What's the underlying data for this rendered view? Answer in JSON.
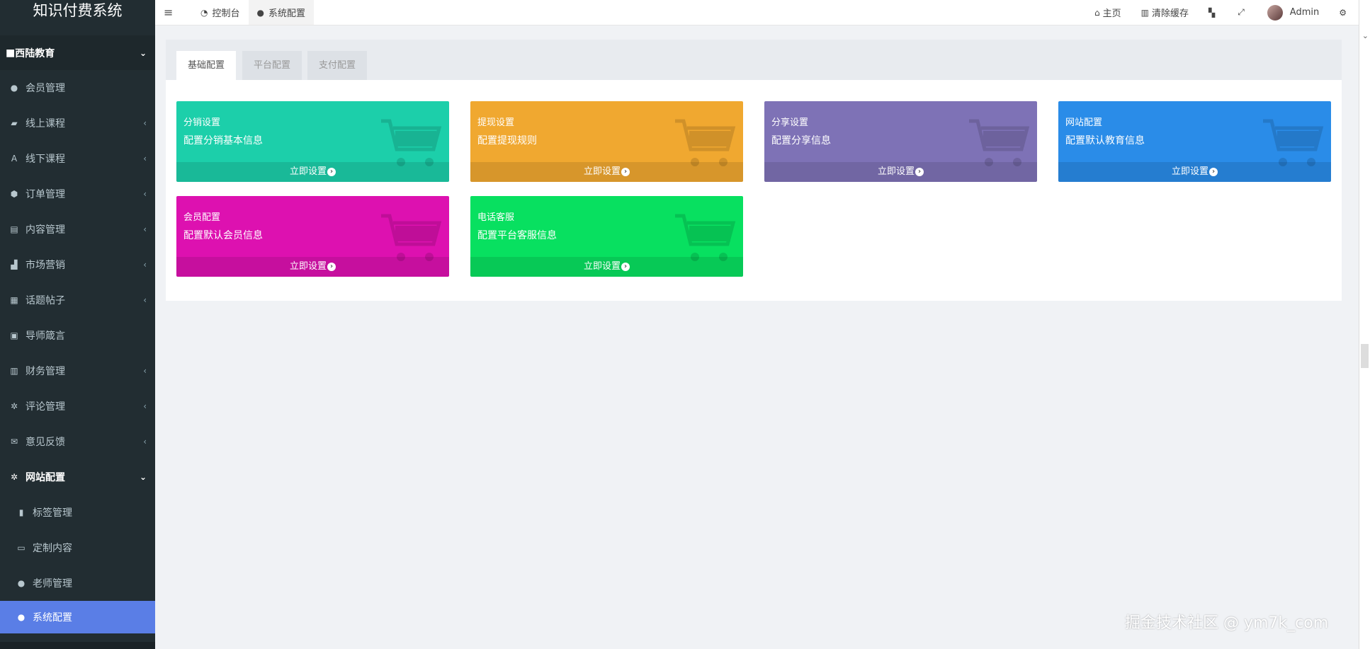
{
  "app": {
    "title": "知识付费系统"
  },
  "sidebar": {
    "group": {
      "label": "西陆教育",
      "icon": "folder-icon"
    },
    "items": [
      {
        "label": "会员管理",
        "icon": "user-icon",
        "caret": ""
      },
      {
        "label": "线上课程",
        "icon": "book-icon",
        "caret": "‹"
      },
      {
        "label": "线下课程",
        "icon": "font-icon",
        "caret": "‹"
      },
      {
        "label": "订单管理",
        "icon": "cube-icon",
        "caret": "‹"
      },
      {
        "label": "内容管理",
        "icon": "list-icon",
        "caret": "‹"
      },
      {
        "label": "市场营销",
        "icon": "chart-icon",
        "caret": "‹"
      },
      {
        "label": "话题帖子",
        "icon": "file-icon",
        "caret": "‹"
      },
      {
        "label": "导师箴言",
        "icon": "calendar-icon",
        "caret": ""
      },
      {
        "label": "财务管理",
        "icon": "bank-icon",
        "caret": "‹"
      },
      {
        "label": "评论管理",
        "icon": "gear-icon",
        "caret": "‹"
      },
      {
        "label": "意见反馈",
        "icon": "envelope-icon",
        "caret": "‹"
      }
    ],
    "group2": {
      "label": "网站配置",
      "icon": "gear-icon"
    },
    "subitems": [
      {
        "label": "标签管理",
        "icon": "bookmark-icon"
      },
      {
        "label": "定制内容",
        "icon": "folder-open-icon"
      },
      {
        "label": "老师管理",
        "icon": "user-plus-icon"
      },
      {
        "label": "系统配置",
        "icon": "user-plus-icon"
      }
    ]
  },
  "topbar": {
    "tabs": [
      {
        "label": "控制台",
        "icon": "dashboard-icon"
      },
      {
        "label": "系统配置",
        "icon": "user-plus-icon"
      }
    ],
    "right": {
      "home": "主页",
      "clear_cache": "清除缓存",
      "user": "Admin"
    }
  },
  "config_tabs": [
    "基础配置",
    "平台配置",
    "支付配置"
  ],
  "cards": [
    {
      "title": "分销设置",
      "desc": "配置分销基本信息",
      "action": "立即设置",
      "color": "#1ccfaa"
    },
    {
      "title": "提现设置",
      "desc": "配置提现规则",
      "action": "立即设置",
      "color": "#f0a830"
    },
    {
      "title": "分享设置",
      "desc": "配置分享信息",
      "action": "立即设置",
      "color": "#7e72b6"
    },
    {
      "title": "网站配置",
      "desc": "配置默认教育信息",
      "action": "立即设置",
      "color": "#2a8ce8"
    },
    {
      "title": "会员配置",
      "desc": "配置默认会员信息",
      "action": "立即设置",
      "color": "#dd11b0"
    },
    {
      "title": "电话客服",
      "desc": "配置平台客服信息",
      "action": "立即设置",
      "color": "#08e060"
    }
  ],
  "watermark": "掘金技术社区 @ ym7k_com"
}
